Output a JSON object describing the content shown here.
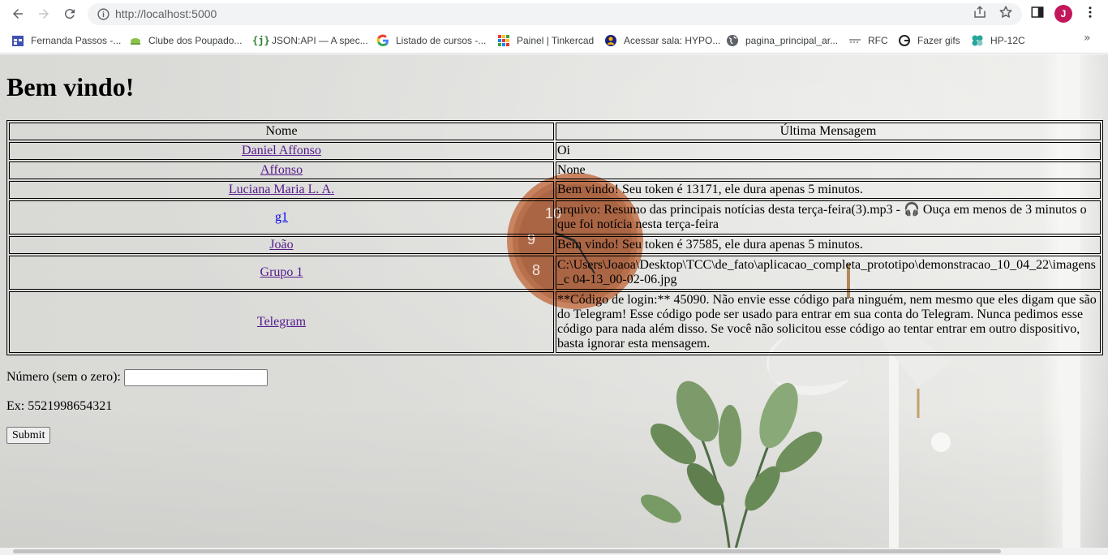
{
  "browser": {
    "url": "http://localhost:5000",
    "profile_initial": "J",
    "bookmarks": [
      {
        "label": "Fernanda Passos -...",
        "icon": "calendar-icon",
        "color": "#3f51b5"
      },
      {
        "label": "Clube dos Poupado...",
        "icon": "leaf-icon",
        "color": "#8bc34a"
      },
      {
        "label": "JSON:API — A spec...",
        "icon": "json-icon",
        "color": "#2e7d32"
      },
      {
        "label": "Listado de cursos -...",
        "icon": "google-icon",
        "color": "#4285f4"
      },
      {
        "label": "Painel | Tinkercad",
        "icon": "tinkercad-icon",
        "color": "#e53935"
      },
      {
        "label": "Acessar sala: HYPO...",
        "icon": "meeting-icon",
        "color": "#1a237e"
      },
      {
        "label": "pagina_principal_ar...",
        "icon": "globe-icon",
        "color": "#5f6368"
      },
      {
        "label": "RFC",
        "icon": "rfc-icon",
        "color": "#9e9e9e"
      },
      {
        "label": "Fazer gifs",
        "icon": "google-icon",
        "color": "#4285f4"
      },
      {
        "label": "HP-12C",
        "icon": "clover-icon",
        "color": "#26a69a"
      }
    ],
    "more_label": "»"
  },
  "page": {
    "title": "Bem vindo!",
    "table": {
      "headers": [
        "Nome",
        "Última Mensagem"
      ],
      "rows": [
        {
          "name": "Daniel Affonso",
          "message": "Oi"
        },
        {
          "name": "Affonso",
          "message": "None"
        },
        {
          "name": "Luciana Maria L. A.",
          "message": "Bem vindo! Seu token é 13171, ele dura apenas 5 minutos."
        },
        {
          "name": "g1",
          "message": "arquivo: Resumo das principais notícias desta terça-feira(3).mp3 - 🎧 Ouça em menos de 3 minutos o que foi notícia nesta terça-feira"
        },
        {
          "name": "João",
          "message": "Bem vindo! Seu token é 37585, ele dura apenas 5 minutos."
        },
        {
          "name": "Grupo 1",
          "message": "C:\\Users\\Joaoa\\Desktop\\TCC\\de_fato\\aplicacao_completa_prototipo\\demonstracao_10_04_22\\imagens_c 04-13_00-02-06.jpg"
        },
        {
          "name": "Telegram",
          "message": "**Código de login:** 45090. Não envie esse código para ninguém, nem mesmo que eles digam que são do Telegram! Esse código pode ser usado para entrar em sua conta do Telegram. Nunca pedimos esse código para nada além disso. Se você não solicitou esse código ao tentar entrar em outro dispositivo, basta ignorar esta mensagem."
        }
      ]
    },
    "form": {
      "number_label": "Número (sem o zero):",
      "number_value": "",
      "example": "Ex: 5521998654321",
      "submit_label": "Submit"
    }
  }
}
